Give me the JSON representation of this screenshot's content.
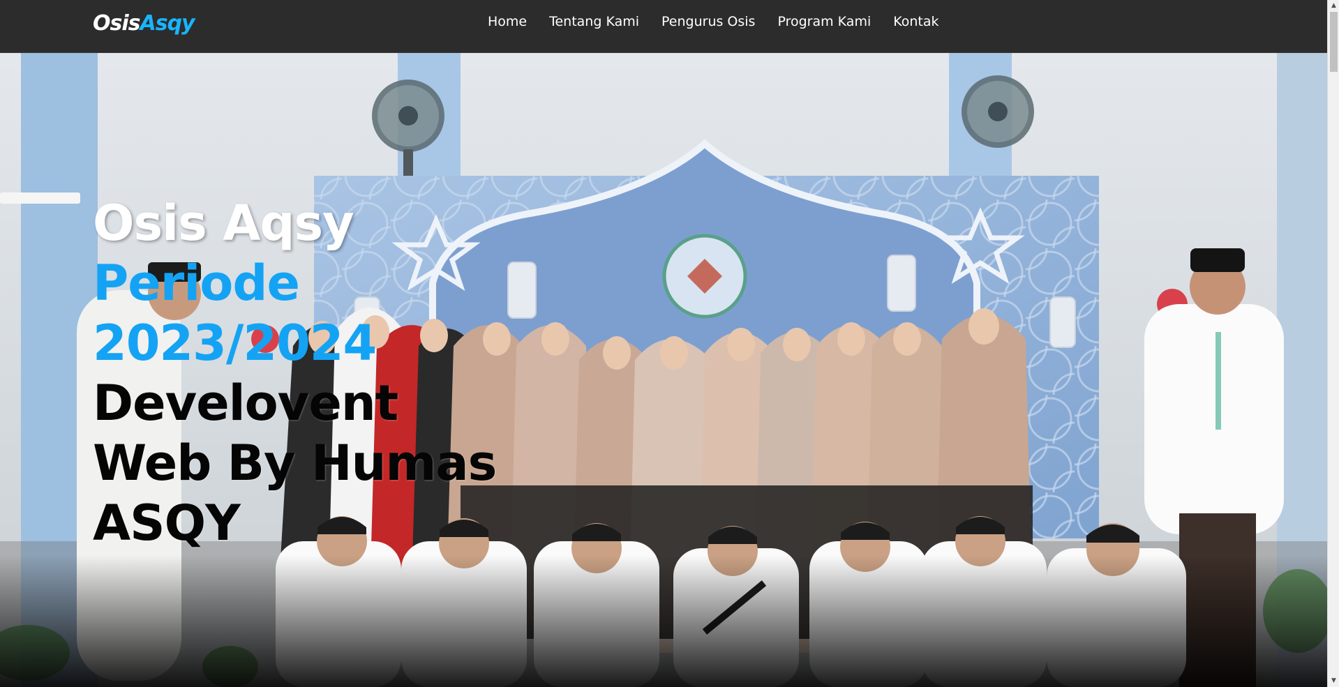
{
  "navbar": {
    "brand": {
      "part1": "Osis",
      "part2": "Asqy"
    },
    "menu": [
      {
        "label": "Home"
      },
      {
        "label": "Tentang Kami"
      },
      {
        "label": "Pengurus Osis"
      },
      {
        "label": "Program Kami"
      },
      {
        "label": "Kontak"
      }
    ]
  },
  "hero": {
    "title": "Osis Aqsy",
    "period_line1": "Periode",
    "period_line2": "2023/2024",
    "credit_line1": "Develovent",
    "credit_line2": "Web By Humas",
    "credit_line3": "ASQY"
  },
  "colors": {
    "navbar_bg": "#2c2c2c",
    "brand_accent": "#19b4ff",
    "hero_blue": "#14a3f4",
    "hero_dark": "#050505"
  },
  "icons": {
    "scroll_up": "triangle-up-icon",
    "scroll_down": "triangle-down-icon"
  }
}
